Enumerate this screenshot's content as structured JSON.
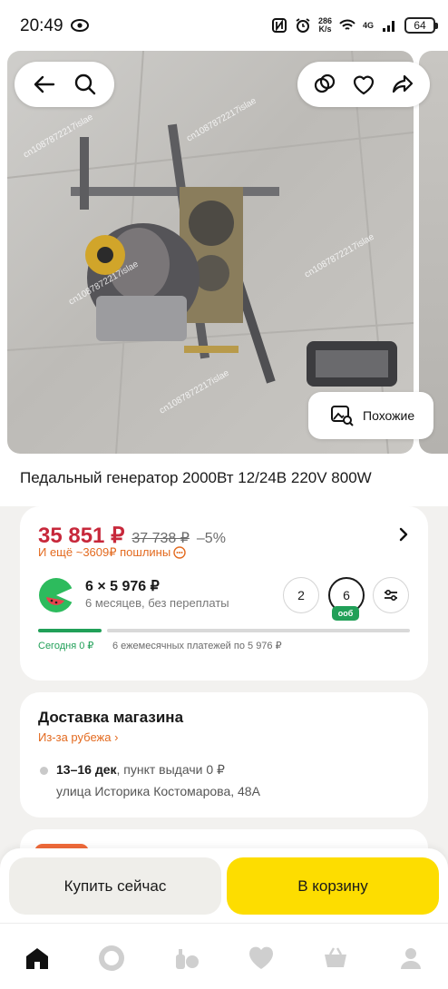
{
  "status_bar": {
    "time": "20:49",
    "speed_value": "286",
    "speed_unit": "K/s",
    "network": "4G",
    "battery": "64",
    "icons": [
      "eye-icon",
      "nfc-icon",
      "alarm-icon",
      "wifi-icon",
      "signal-icon",
      "battery-icon"
    ]
  },
  "gallery": {
    "watermark": "cn1087872217islae",
    "similar_label": "Похожие",
    "icons": [
      "back-arrow-icon",
      "search-icon",
      "compare-icon",
      "heart-icon",
      "share-icon",
      "image-search-icon"
    ]
  },
  "product": {
    "title": "Педальный генератор 2000Вт 12/24В 220V 800W"
  },
  "price": {
    "current": "35 851 ₽",
    "old": "37 738 ₽",
    "discount": "–5%",
    "duty": "И ещё ~3609₽ пошлины"
  },
  "split": {
    "amount": "6 × 5 976 ₽",
    "subtitle": "6 месяцев, без переплаты",
    "terms": [
      "2",
      "6"
    ],
    "selected_tag": "ооб",
    "today": "Сегодня 0 ₽",
    "monthly": "6 ежемесячных платежей по 5 976 ₽",
    "progress_paid_fraction": 0.17
  },
  "delivery": {
    "title": "Доставка магазина",
    "origin": "Из-за рубежа ›",
    "dates": "13–16 дек",
    "pickup": ", пункт выдачи  0 ₽",
    "address": "улица Историка Костомарова, 48А"
  },
  "actions": {
    "buy_now": "Купить сейчас",
    "add_to_cart": "В корзину"
  },
  "nav": {
    "icons": [
      "home-icon",
      "alice-icon",
      "catalog-icon",
      "favorites-icon",
      "cart-icon",
      "profile-icon"
    ]
  },
  "colors": {
    "price_red": "#c7283b",
    "accent_orange": "#e36a1f",
    "split_green": "#21a058",
    "cart_yellow": "#fddd00"
  }
}
